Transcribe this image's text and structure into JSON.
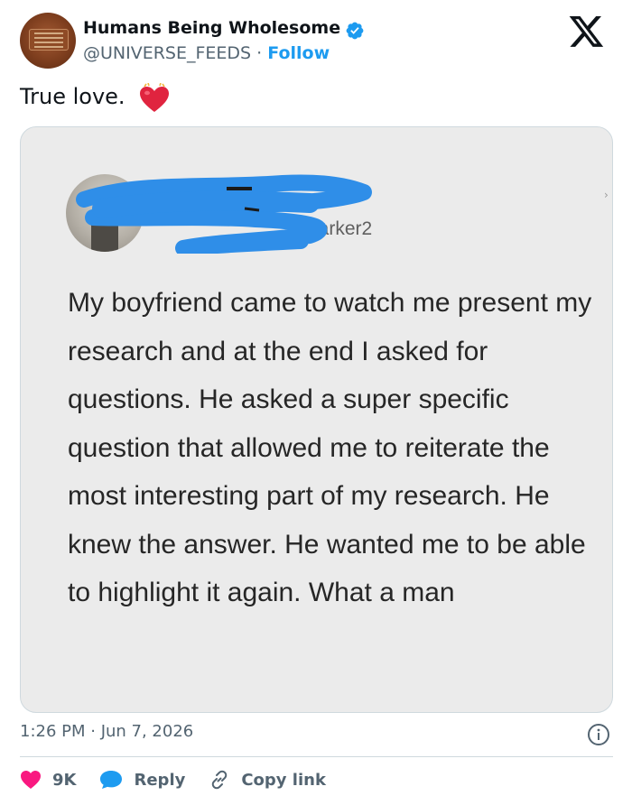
{
  "account": {
    "name": "Humans Being Wholesome",
    "handle": "@UNIVERSE_FEEDS",
    "separator": "·",
    "follow_label": "Follow",
    "verified": true,
    "brand_color": "#1d9bf0"
  },
  "platform_logo": "x-logo-icon",
  "tweet": {
    "text": "True love.",
    "emoji": "heart-emoji"
  },
  "embedded_post": {
    "handle_fragment": "parker2",
    "body": "My boyfriend came to watch me present my research and at the end I asked for questions. He asked a super specific question that allowed me to reiterate the most interesting part of my research. He knew the answer. He wanted me to be able to highlight it again. What a man",
    "redaction_color": "#2f8ee8"
  },
  "meta": {
    "timestamp": "1:26 PM · Jun 7, 2026",
    "info_icon": "info-icon"
  },
  "actions": {
    "likes_count": "9K",
    "reply_label": "Reply",
    "copy_link_label": "Copy link",
    "like_color": "#f91880",
    "reply_color": "#1d9bf0"
  }
}
